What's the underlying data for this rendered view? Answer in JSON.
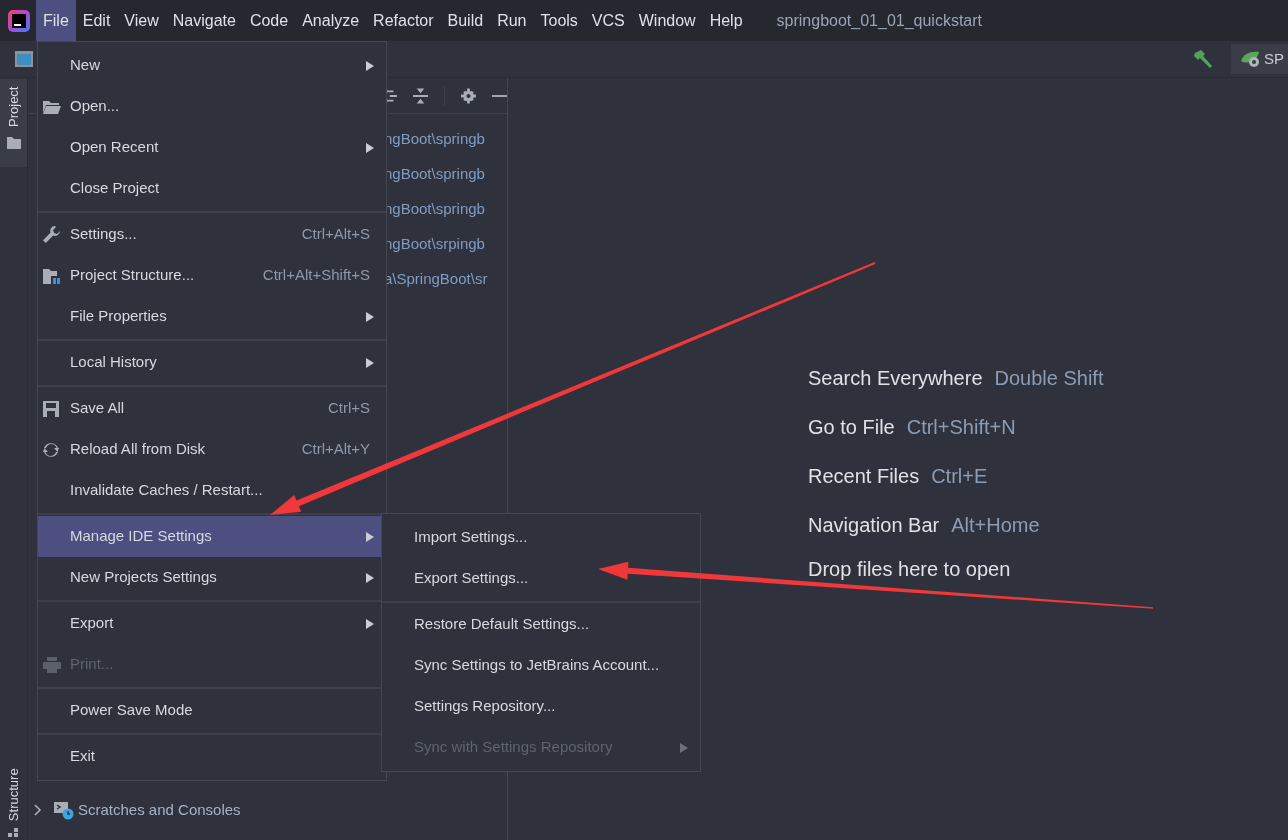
{
  "menu_bar": {
    "items": [
      {
        "label": "File",
        "selected": true
      },
      {
        "label": "Edit",
        "selected": false
      },
      {
        "label": "View",
        "selected": false
      },
      {
        "label": "Navigate",
        "selected": false
      },
      {
        "label": "Code",
        "selected": false
      },
      {
        "label": "Analyze",
        "selected": false
      },
      {
        "label": "Refactor",
        "selected": false
      },
      {
        "label": "Build",
        "selected": false
      },
      {
        "label": "Run",
        "selected": false
      },
      {
        "label": "Tools",
        "selected": false
      },
      {
        "label": "VCS",
        "selected": false
      },
      {
        "label": "Window",
        "selected": false
      },
      {
        "label": "Help",
        "selected": false
      }
    ],
    "project_title": "springboot_01_01_quickstart"
  },
  "toolbar": {
    "run_config": "SP"
  },
  "tool_window_tabs": [
    {
      "label": "Project",
      "selected": true
    },
    {
      "label": "Structure",
      "selected": false
    }
  ],
  "project_panel": {
    "rows": [
      "ngBoot\\springb",
      "ngBoot\\springb",
      "ngBoot\\springb",
      "ngBoot\\srpingb",
      "a\\SpringBoot\\sr"
    ],
    "tree_item": "Scratches and Consoles"
  },
  "file_menu": {
    "groups": [
      [
        {
          "label": "New",
          "submenu": true,
          "disabled": false,
          "selected": false
        },
        {
          "label": "Open...",
          "submenu": false,
          "disabled": false,
          "selected": false
        },
        {
          "label": "Open Recent",
          "submenu": true,
          "disabled": false,
          "selected": false
        },
        {
          "label": "Close Project",
          "submenu": false,
          "disabled": false,
          "selected": false
        }
      ],
      [
        {
          "label": "Settings...",
          "shortcut": "Ctrl+Alt+S",
          "submenu": false,
          "disabled": false,
          "selected": false
        },
        {
          "label": "Project Structure...",
          "shortcut": "Ctrl+Alt+Shift+S",
          "submenu": false,
          "disabled": false,
          "selected": false
        },
        {
          "label": "File Properties",
          "submenu": true,
          "disabled": false,
          "selected": false
        }
      ],
      [
        {
          "label": "Local History",
          "submenu": true,
          "disabled": false,
          "selected": false
        }
      ],
      [
        {
          "label": "Save All",
          "shortcut": "Ctrl+S",
          "submenu": false,
          "disabled": false,
          "selected": false
        },
        {
          "label": "Reload All from Disk",
          "shortcut": "Ctrl+Alt+Y",
          "submenu": false,
          "disabled": false,
          "selected": false
        },
        {
          "label": "Invalidate Caches / Restart...",
          "submenu": false,
          "disabled": false,
          "selected": false
        }
      ],
      [
        {
          "label": "Manage IDE Settings",
          "submenu": true,
          "disabled": false,
          "selected": true
        },
        {
          "label": "New Projects Settings",
          "submenu": true,
          "disabled": false,
          "selected": false
        }
      ],
      [
        {
          "label": "Export",
          "submenu": true,
          "disabled": false,
          "selected": false
        },
        {
          "label": "Print...",
          "submenu": false,
          "disabled": true,
          "selected": false
        }
      ],
      [
        {
          "label": "Power Save Mode",
          "submenu": false,
          "disabled": false,
          "selected": false
        }
      ],
      [
        {
          "label": "Exit",
          "submenu": false,
          "disabled": false,
          "selected": false
        }
      ]
    ]
  },
  "submenu": {
    "groups": [
      [
        {
          "label": "Import Settings...",
          "submenu": false,
          "disabled": false
        },
        {
          "label": "Export Settings...",
          "submenu": false,
          "disabled": false
        }
      ],
      [
        {
          "label": "Restore Default Settings...",
          "submenu": false,
          "disabled": false
        },
        {
          "label": "Sync Settings to JetBrains Account...",
          "submenu": false,
          "disabled": false
        },
        {
          "label": "Settings Repository...",
          "submenu": false,
          "disabled": false
        },
        {
          "label": "Sync with Settings Repository",
          "submenu": true,
          "disabled": true
        }
      ]
    ]
  },
  "welcome": {
    "hints": [
      {
        "action": "Search Everywhere",
        "shortcut": "Double Shift"
      },
      {
        "action": "Go to File",
        "shortcut": "Ctrl+Shift+N"
      },
      {
        "action": "Recent Files",
        "shortcut": "Ctrl+E"
      },
      {
        "action": "Navigation Bar",
        "shortcut": "Alt+Home"
      }
    ],
    "drop_text": "Drop files here to open"
  }
}
